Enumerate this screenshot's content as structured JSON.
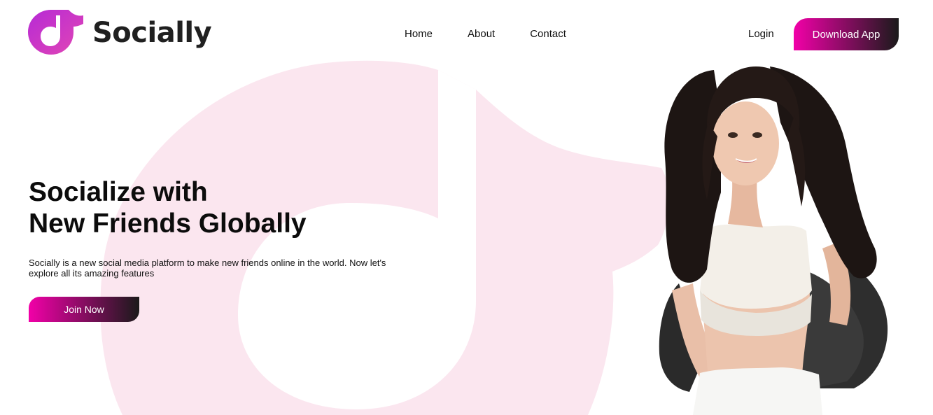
{
  "brand": {
    "name": "Socially",
    "logo_icon": "music-note-bubble-icon"
  },
  "nav": {
    "items": [
      {
        "label": "Home"
      },
      {
        "label": "About"
      },
      {
        "label": "Contact"
      }
    ],
    "login_label": "Login",
    "download_label": "Download App"
  },
  "hero": {
    "title_line1": "Socialize with",
    "title_line2": "New Friends Globally",
    "description": "Socially is a new social media platform to make new friends online in the world. Now let's explore all its amazing features",
    "join_label": "Join Now",
    "image": "woman-curly-hair-photo"
  },
  "colors": {
    "accent_start": "#f200a8",
    "accent_end": "#1a1a1a",
    "logo_start": "#c02ad0",
    "logo_end": "#e043b6",
    "bg_shape": "#fbe6ef"
  }
}
